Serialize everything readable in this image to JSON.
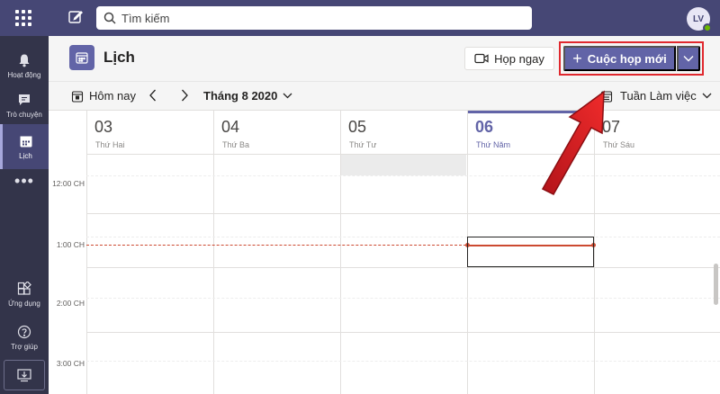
{
  "search": {
    "placeholder": "Tìm kiếm"
  },
  "user": {
    "initials": "LV"
  },
  "rail": {
    "activity": "Hoạt động",
    "chat": "Trò chuyện",
    "calendar": "Lịch",
    "apps": "Ứng dụng",
    "help": "Trợ giúp"
  },
  "header": {
    "title": "Lịch",
    "meet_now": "Họp ngay",
    "new_meeting": "Cuộc họp mới"
  },
  "toolbar": {
    "today": "Hôm nay",
    "month": "Tháng 8 2020",
    "view": "Tuần Làm việc"
  },
  "days": [
    {
      "num": "03",
      "name": "Thứ Hai"
    },
    {
      "num": "04",
      "name": "Thứ Ba"
    },
    {
      "num": "05",
      "name": "Thứ Tư"
    },
    {
      "num": "06",
      "name": "Thứ Năm"
    },
    {
      "num": "07",
      "name": "Thứ Sáu"
    }
  ],
  "times": [
    "12:00 CH",
    "1:00 CH",
    "2:00 CH",
    "3:00 CH"
  ],
  "colors": {
    "brand": "#6264a7",
    "topbar": "#464775",
    "rail": "#33344a",
    "now": "#cc4a31",
    "highlight": "#e0282e"
  }
}
